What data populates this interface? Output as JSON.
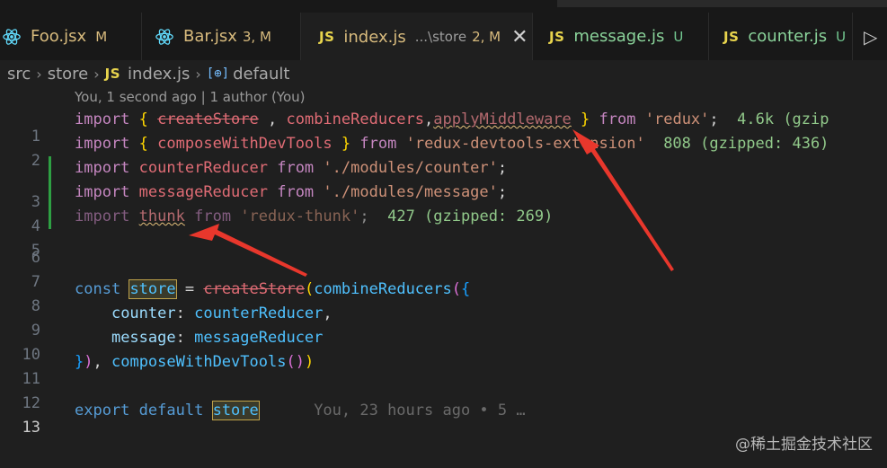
{
  "tabs": [
    {
      "name": "Foo.jsx",
      "badge": "M",
      "kind": "react"
    },
    {
      "name": "Bar.jsx",
      "badge": "3, M",
      "kind": "react"
    },
    {
      "name": "index.js",
      "desc": "...\\store",
      "badge": "2, M",
      "kind": "js",
      "active": true,
      "close": "✕"
    },
    {
      "name": "message.js",
      "badge": "U",
      "kind": "js"
    },
    {
      "name": "counter.js",
      "badge": "U",
      "kind": "js"
    }
  ],
  "js_label": "JS",
  "run_icon": "▷",
  "breadcrumb": {
    "seg1": "src",
    "seg2": "store",
    "file_icon": "JS",
    "file": "index.js",
    "symbol_icon": "[⊕]",
    "symbol": "default"
  },
  "blame_header": "You, 1 second ago | 1 author (You)",
  "lines": {
    "l1": {
      "n": "1",
      "import": "import",
      "ob": "{",
      "createStore": "createStore",
      "comma1": " , ",
      "combineReducers": "combineReducers",
      "comma2": ",",
      "applyMiddleware": "applyMiddleware",
      "cb": "}",
      "from": "from",
      "source": "'redux'",
      "semi": ";",
      "size": "4.6k (gzip"
    },
    "l2": {
      "n": "2",
      "import": "import",
      "ob": "{",
      "composeWithDevTools": "composeWithDevTools",
      "cb": "}",
      "from": "from",
      "source": "'redux-devtools-extension'",
      "size": "808 (gzipped: 436)"
    },
    "l3": {
      "n": "3",
      "import": "import",
      "name": "counterReducer",
      "from": "from",
      "source": "'./modules/counter'",
      "semi": ";"
    },
    "l4": {
      "n": "4",
      "import": "import",
      "name": "messageReducer",
      "from": "from",
      "source": "'./modules/message'",
      "semi": ";"
    },
    "l5": {
      "n": "5",
      "import": "import",
      "name": "thunk",
      "from": "from",
      "source": "'redux-thunk'",
      "semi": ";",
      "size": "427 (gzipped: 269)"
    },
    "l6": {
      "n": "6"
    },
    "l7": {
      "n": "7"
    },
    "l8": {
      "n": "8",
      "const": "const",
      "store": "store",
      "eq": "=",
      "createStore": "createStore",
      "p1": "(",
      "combineReducers": "combineReducers",
      "p2": "(",
      "ob": "{"
    },
    "l9": {
      "n": "9",
      "key": "counter",
      "colon": ":",
      "val": "counterReducer",
      "comma": ","
    },
    "l10": {
      "n": "10",
      "key": "message",
      "colon": ":",
      "val": "messageReducer"
    },
    "l11": {
      "n": "11",
      "cb": "}",
      "p2": ")",
      "comma": ", ",
      "compose": "composeWithDevTools",
      "p3": "()",
      "p1": ")"
    },
    "l12": {
      "n": "12"
    },
    "l13": {
      "n": "13",
      "export": "export",
      "default": "default",
      "store": "store",
      "blame": "You, 23 hours ago • 5 …"
    }
  },
  "watermark": "@稀土掘金技术社区",
  "colors": {
    "arrow": "#e8372c",
    "git_added": "#2ea043",
    "warning": "#e5c07b"
  }
}
